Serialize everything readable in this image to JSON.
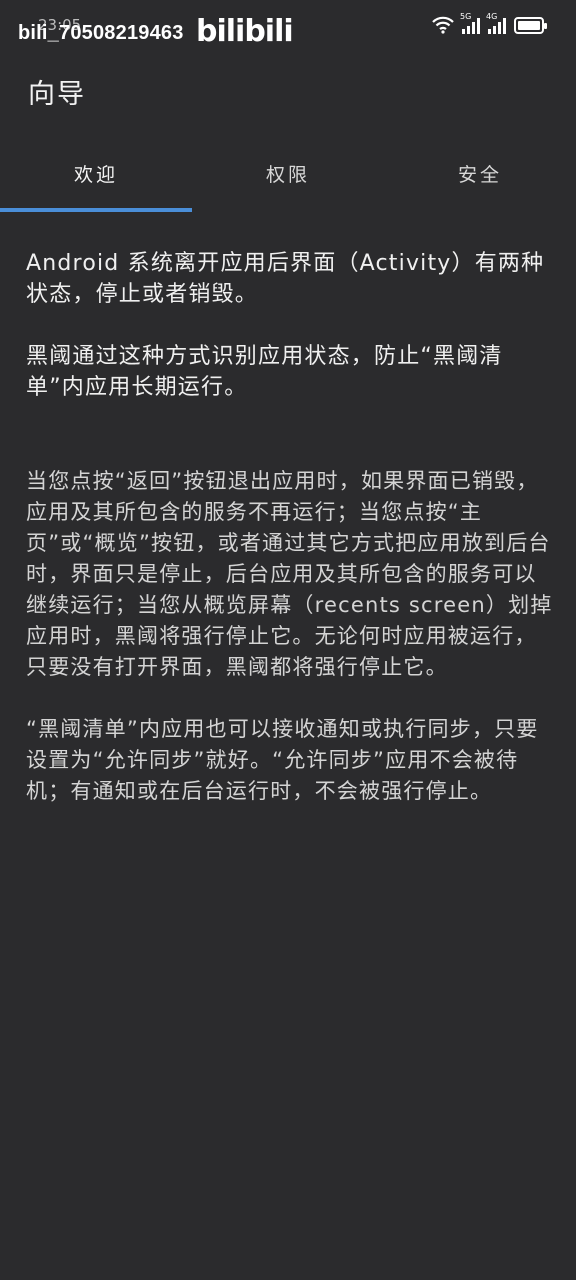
{
  "status_bar": {
    "time": "23:05",
    "watermark_user": "bili_70508219463",
    "watermark_logo": "bilibili",
    "net_5g": "5G",
    "net_4g": "4G"
  },
  "header": {
    "title": "向导"
  },
  "tabs": [
    {
      "label": "欢迎",
      "active": true
    },
    {
      "label": "权限",
      "active": false
    },
    {
      "label": "安全",
      "active": false
    }
  ],
  "content": {
    "p1": "Android 系统离开应用后界面（Activity）有两种状态，停止或者销毁。",
    "p2": "黑阈通过这种方式识别应用状态，防止“黑阈清单”内应用长期运行。",
    "p3": "当您点按“返回”按钮退出应用时，如果界面已销毁，应用及其所包含的服务不再运行；当您点按“主页”或“概览”按钮，或者通过其它方式把应用放到后台时，界面只是停止，后台应用及其所包含的服务可以继续运行；当您从概览屏幕（recents screen）划掉应用时，黑阈将强行停止它。无论何时应用被运行，只要没有打开界面，黑阈都将强行停止它。",
    "p4": "“黑阈清单”内应用也可以接收通知或执行同步，只要设置为“允许同步”就好。“允许同步”应用不会被待机；有通知或在后台运行时，不会被强行停止。"
  },
  "colors": {
    "background": "#2b2b2d",
    "tab_indicator": "#4a8ed8"
  }
}
